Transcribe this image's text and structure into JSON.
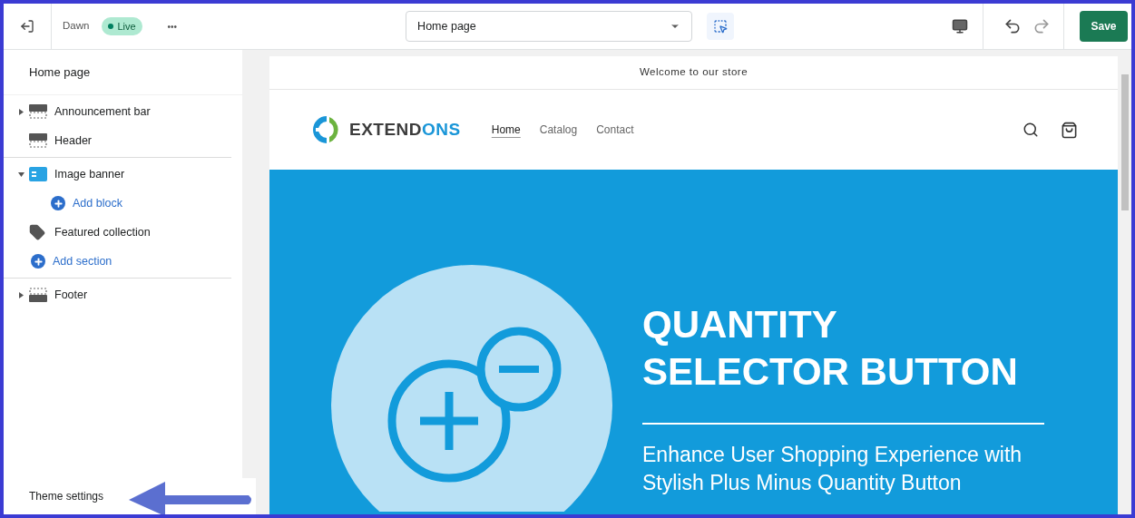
{
  "topbar": {
    "theme_name": "Dawn",
    "status_badge": "Live",
    "more_label": "•••",
    "page_select": {
      "value": "Home page"
    },
    "save_button": "Save"
  },
  "sidebar": {
    "title": "Home page",
    "groups": [
      {
        "items": [
          {
            "kind": "bar",
            "label": "Announcement bar",
            "expanded": false
          },
          {
            "kind": "bar",
            "label": "Header"
          }
        ]
      },
      {
        "items": [
          {
            "kind": "banner",
            "label": "Image banner",
            "expanded": true,
            "children": [
              {
                "kind": "add",
                "label": "Add block"
              }
            ]
          },
          {
            "kind": "tag",
            "label": "Featured collection"
          },
          {
            "kind": "add",
            "label": "Add section"
          }
        ]
      },
      {
        "items": [
          {
            "kind": "footer",
            "label": "Footer",
            "expanded": false
          }
        ]
      }
    ],
    "footer_link": "Theme settings"
  },
  "preview": {
    "announcement": "Welcome to our store",
    "logo": [
      "EXTEND",
      "ONS"
    ],
    "nav": [
      {
        "label": "Home",
        "selected": true
      },
      {
        "label": "Catalog",
        "selected": false
      },
      {
        "label": "Contact",
        "selected": false
      }
    ],
    "banner": {
      "heading": [
        "QUANTITY",
        "SELECTOR BUTTON"
      ],
      "subheading": [
        "Enhance User Shopping Experience with",
        "Stylish Plus Minus Quantity Button"
      ]
    }
  }
}
